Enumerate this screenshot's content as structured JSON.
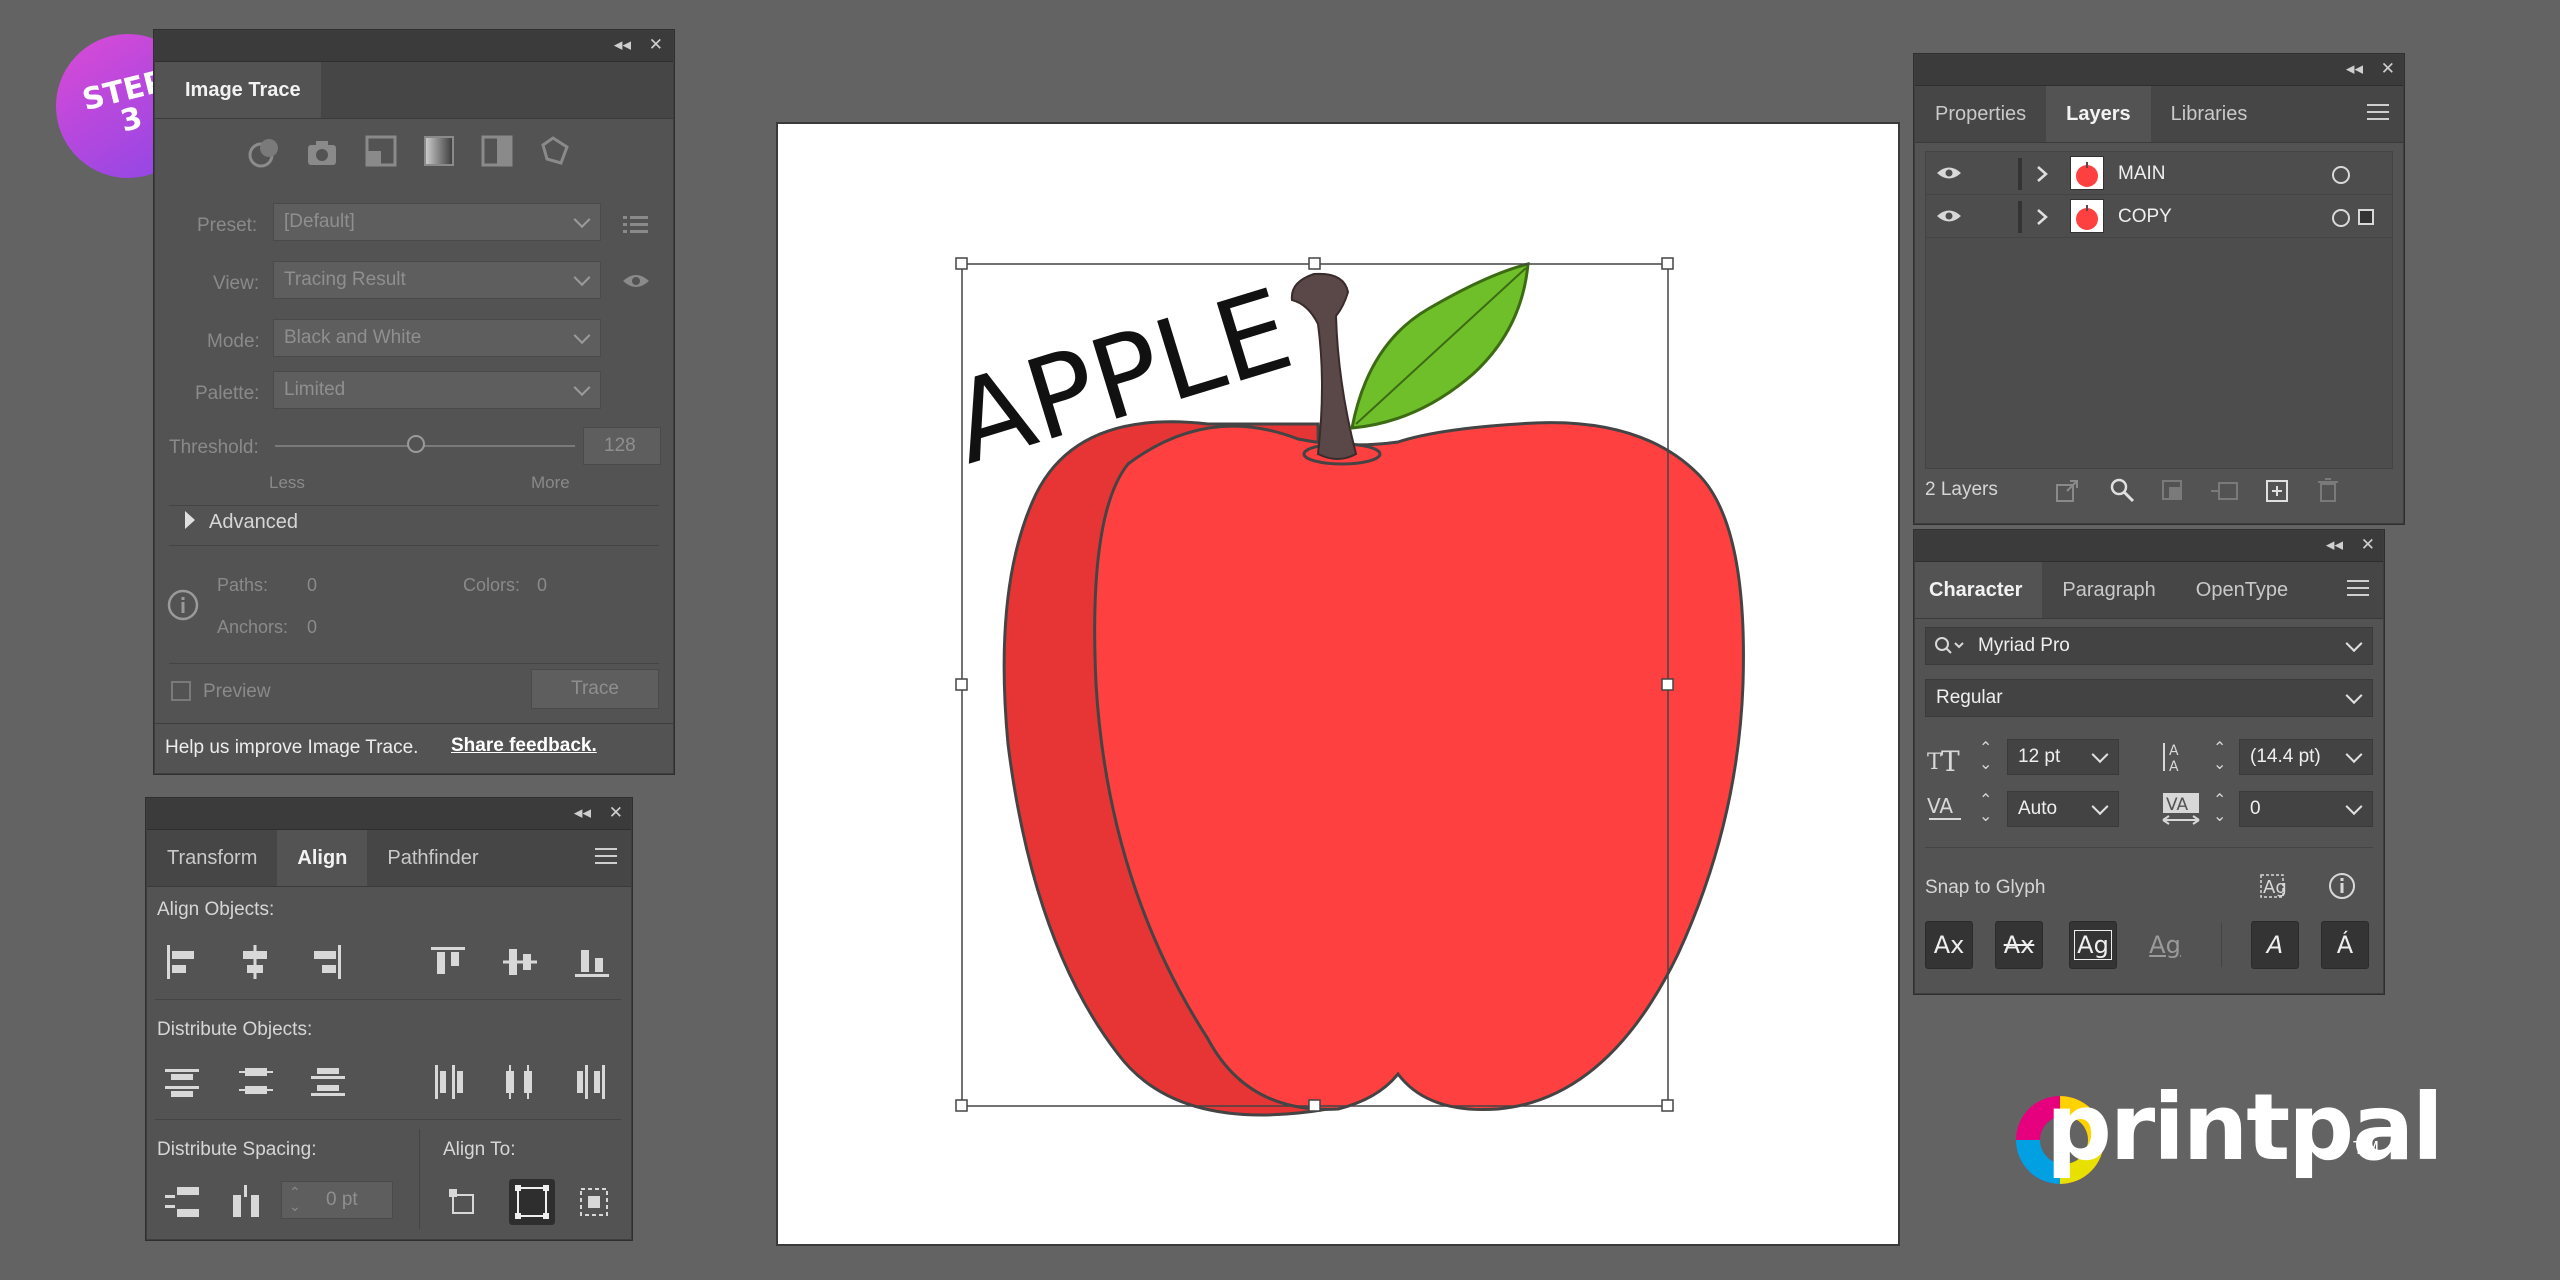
{
  "badge": {
    "line1": "STEP",
    "line2": "3"
  },
  "image_trace": {
    "tab": "Image Trace",
    "preset_label": "Preset:",
    "preset_value": "[Default]",
    "view_label": "View:",
    "view_value": "Tracing Result",
    "mode_label": "Mode:",
    "mode_value": "Black and White",
    "palette_label": "Palette:",
    "palette_value": "Limited",
    "threshold_label": "Threshold:",
    "threshold_value": "128",
    "threshold_level_percent": 50,
    "less": "Less",
    "more": "More",
    "advanced": "Advanced",
    "paths_label": "Paths:",
    "paths_value": "0",
    "colors_label": "Colors:",
    "colors_value": "0",
    "anchors_label": "Anchors:",
    "anchors_value": "0",
    "preview": "Preview",
    "trace": "Trace",
    "feedback_text": "Help us improve Image Trace.",
    "feedback_link": "Share feedback."
  },
  "align": {
    "tabs": [
      "Transform",
      "Align",
      "Pathfinder"
    ],
    "align_objects": "Align Objects:",
    "distribute_objects": "Distribute Objects:",
    "distribute_spacing": "Distribute Spacing:",
    "align_to": "Align To:",
    "spacing_value": "0 pt"
  },
  "layers": {
    "tabs": [
      "Properties",
      "Layers",
      "Libraries"
    ],
    "rows": [
      {
        "name": "MAIN"
      },
      {
        "name": "COPY"
      }
    ],
    "count": "2 Layers"
  },
  "character": {
    "tabs": [
      "Character",
      "Paragraph",
      "OpenType"
    ],
    "font": "Myriad Pro",
    "style": "Regular",
    "size": "12 pt",
    "leading": "(14.4 pt)",
    "kerning": "Auto",
    "tracking": "0",
    "snap": "Snap to Glyph"
  },
  "canvas": {
    "text": "APPLE"
  },
  "logo": {
    "text": "printpal",
    "tm": "TM"
  },
  "colors": {
    "accent_red": "#ff4040",
    "leaf": "#6fbf2a",
    "stem": "#5a4747"
  }
}
